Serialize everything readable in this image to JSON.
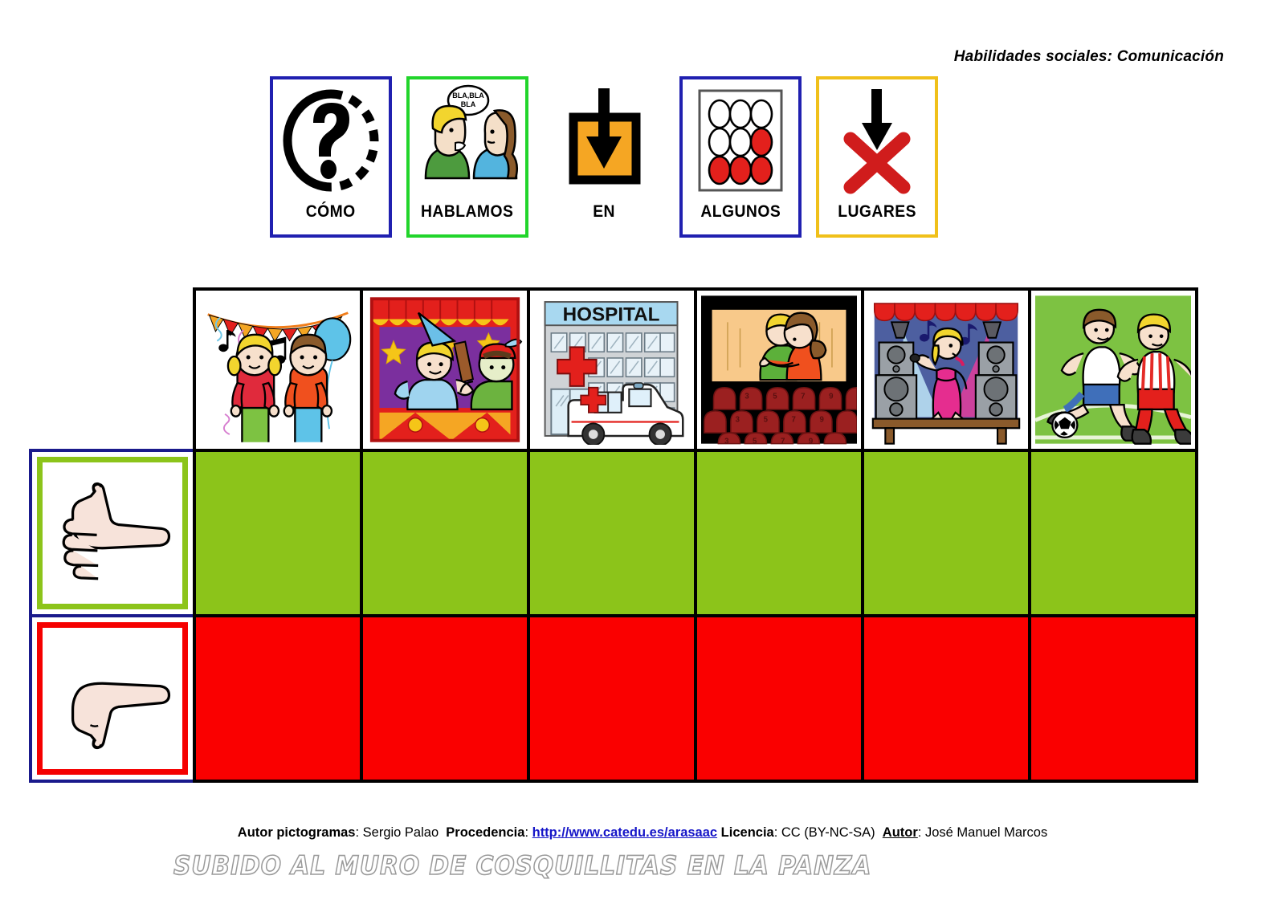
{
  "category_label": "Habilidades sociales: Comunicación",
  "sentence": {
    "cards": [
      {
        "label": "CÓMO",
        "icon": "question-mark-icon",
        "border_color": "#2020b0",
        "border": "blue"
      },
      {
        "label": "HABLAMOS",
        "icon": "two-people-talking-icon",
        "border_color": "#22d52b",
        "border": "green",
        "speech_bubble": "BLA,BLA BLA"
      },
      {
        "label": "EN",
        "icon": "arrow-into-box-icon",
        "border_color": "none",
        "border": "none"
      },
      {
        "label": "ALGUNOS",
        "icon": "some-dots-icon",
        "border_color": "#2020b0",
        "border": "blue"
      },
      {
        "label": "LUGARES",
        "icon": "arrow-and-red-cross-icon",
        "border_color": "#f0c01a",
        "border": "yellow"
      }
    ]
  },
  "grid": {
    "places": [
      {
        "name": "fiesta",
        "icon": "party-children-icon"
      },
      {
        "name": "teatro",
        "icon": "puppet-theater-icon"
      },
      {
        "name": "hospital",
        "icon": "hospital-ambulance-icon",
        "sign_text": "HOSPITAL"
      },
      {
        "name": "cine",
        "icon": "cinema-screen-icon",
        "seat_numbers": [
          "3",
          "5",
          "7",
          "9"
        ]
      },
      {
        "name": "concierto",
        "icon": "concert-singer-icon"
      },
      {
        "name": "futbol",
        "icon": "soccer-match-icon"
      }
    ],
    "rows": [
      {
        "name": "si",
        "icon": "thumbs-up-icon",
        "cell_color": "#8cc41a",
        "inner_border": "#8cc41a"
      },
      {
        "name": "no",
        "icon": "thumbs-down-icon",
        "cell_color": "#fa0000",
        "inner_border": "#f50000"
      }
    ]
  },
  "credits": {
    "author_pictograms_label": "Autor pictogramas",
    "author_pictograms_value": "Sergio Palao",
    "source_label": "Procedencia",
    "source_value": "http://www.catedu.es/arasaac",
    "license_label": "Licencia",
    "license_value": "CC (BY-NC-SA)",
    "author_label": "Autor",
    "author_value": "José Manuel Marcos"
  },
  "wall_note": "SUBIDO AL MURO DE COSQUILLITAS EN LA PANZA",
  "colors": {
    "green": "#8cc41a",
    "red": "#fa0000",
    "blue_border": "#2020b0",
    "yellow_border": "#f0c01a",
    "orange": "#f5a623",
    "link_blue": "#1616c8"
  }
}
